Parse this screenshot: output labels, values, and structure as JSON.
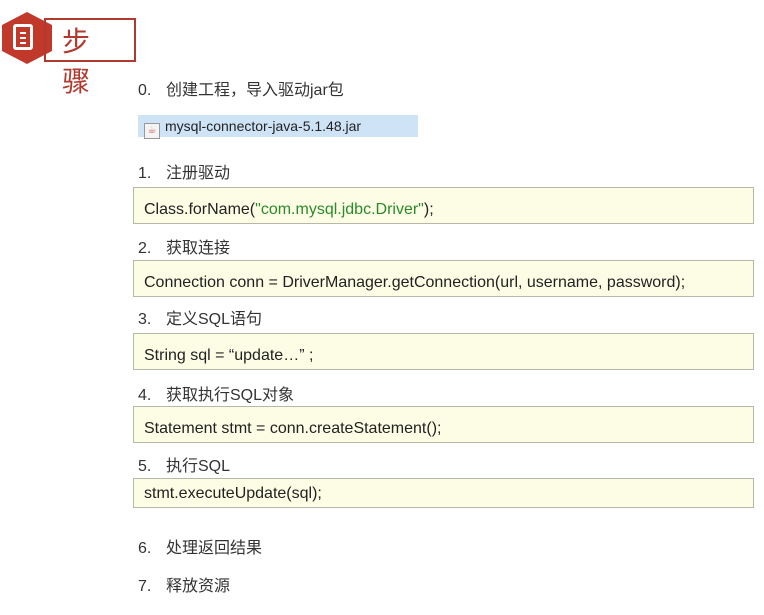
{
  "header": {
    "title": "步骤",
    "icon": "document-icon",
    "accent": "#c0392b"
  },
  "steps": [
    {
      "num": "0.",
      "label": "创建工程，导入驱动jar包"
    },
    {
      "num": "1.",
      "label": "注册驱动"
    },
    {
      "num": "2.",
      "label": "获取连接"
    },
    {
      "num": "3.",
      "label": "定义SQL语句"
    },
    {
      "num": "4.",
      "label": "获取执行SQL对象"
    },
    {
      "num": "5.",
      "label": "执行SQL"
    },
    {
      "num": "6.",
      "label": "处理返回结果"
    },
    {
      "num": "7.",
      "label": "释放资源"
    }
  ],
  "jar_file": {
    "name": "mysql-connector-java-5.1.48.jar",
    "icon": "java-file-icon"
  },
  "code": {
    "c1_pre": "Class.forName(",
    "c1_str": "\"com.mysql.jdbc.Driver\"",
    "c1_post": ");",
    "c2": "Connection conn = DriverManager.getConnection(url, username, password);",
    "c3": "String sql =  “update…” ;",
    "c4": "Statement stmt = conn.createStatement();",
    "c5": "stmt.executeUpdate(sql);"
  }
}
